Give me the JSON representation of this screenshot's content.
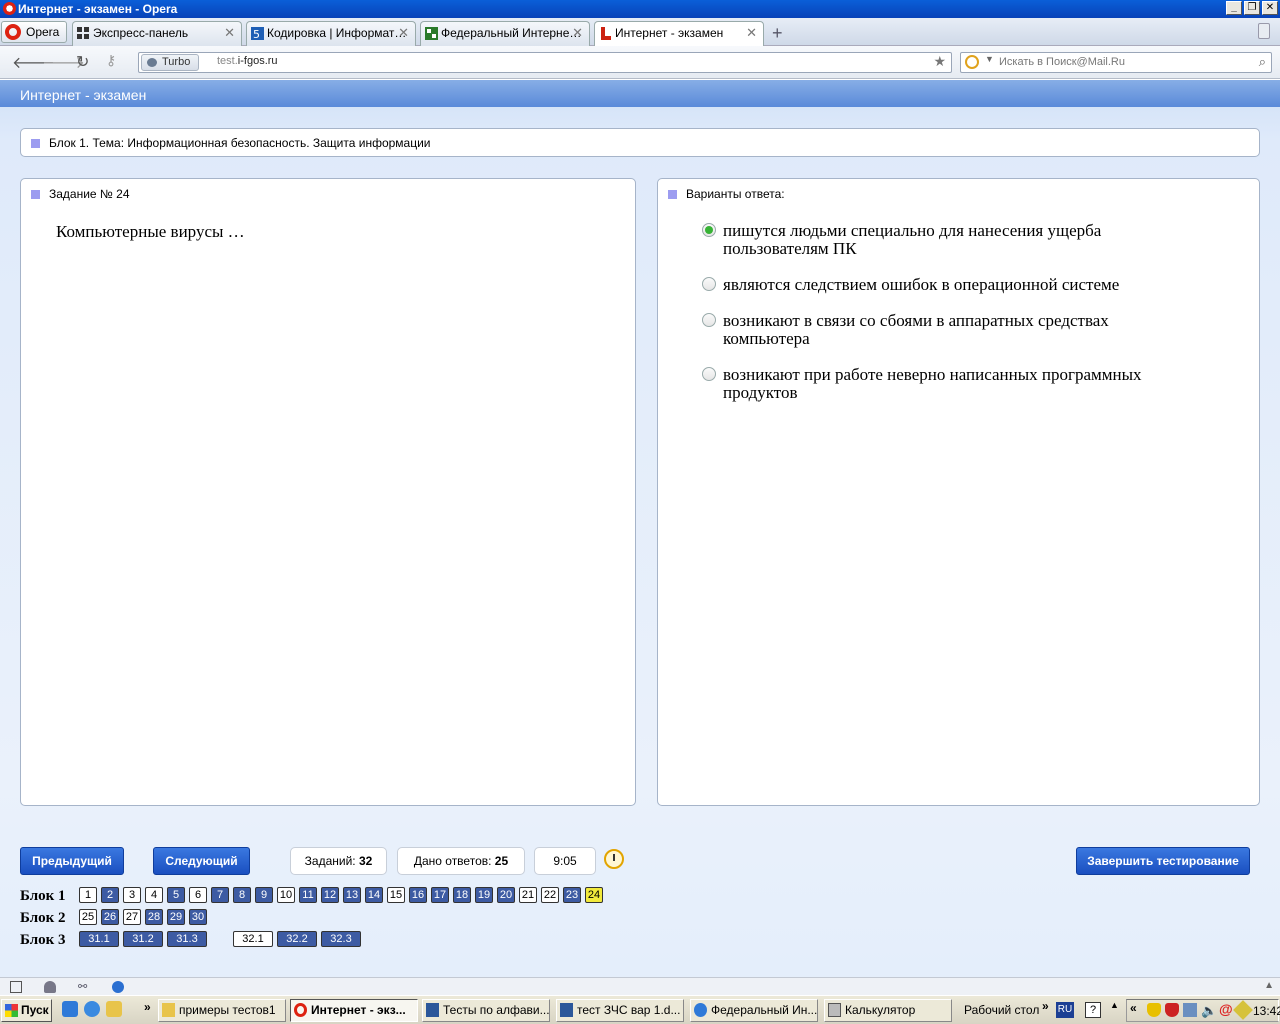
{
  "window": {
    "title": "Интернет - экзамен - Opera"
  },
  "browser": {
    "menu_label": "Opera",
    "tabs": [
      {
        "label": "Экспресс-панель",
        "active": false
      },
      {
        "label": "Кодировка | Информат…",
        "active": false
      },
      {
        "label": "Федеральный Интерне…",
        "active": false
      },
      {
        "label": "Интернет - экзамен",
        "active": true
      }
    ],
    "turbo_label": "Turbo",
    "url_prefix": "test.",
    "url_domain": "i-fgos.ru",
    "search_placeholder": "Искать в Поиск@Mail.Ru"
  },
  "page": {
    "header": "Интернет - экзамен",
    "block_title": "Блок 1. Тема: Информационная безопасность. Защита информации",
    "task_title": "Задание № 24",
    "question": "Компьютерные вирусы …",
    "answers_title": "Варианты ответа:",
    "answers": [
      {
        "text": "пишутся людьми специально для нанесения ущерба пользователям ПК",
        "selected": true
      },
      {
        "text": "являются следствием ошибок в операционной системе",
        "selected": false
      },
      {
        "text": "возникают в связи со сбоями в аппаратных средствах компьютера",
        "selected": false
      },
      {
        "text": "возникают при работе неверно написанных программных продуктов",
        "selected": false
      }
    ],
    "prev_label": "Предыдущий",
    "next_label": "Следующий",
    "tasks_label": "Заданий:",
    "tasks_count": "32",
    "answered_label": "Дано ответов:",
    "answered_count": "25",
    "timer": "9:05",
    "finish_label": "Завершить тестирование",
    "blocks": [
      {
        "label": "Блок 1",
        "items": [
          {
            "n": "1",
            "state": "white"
          },
          {
            "n": "2",
            "state": "blue"
          },
          {
            "n": "3",
            "state": "white"
          },
          {
            "n": "4",
            "state": "white"
          },
          {
            "n": "5",
            "state": "blue"
          },
          {
            "n": "6",
            "state": "white"
          },
          {
            "n": "7",
            "state": "blue"
          },
          {
            "n": "8",
            "state": "blue"
          },
          {
            "n": "9",
            "state": "blue"
          },
          {
            "n": "10",
            "state": "white"
          },
          {
            "n": "11",
            "state": "blue"
          },
          {
            "n": "12",
            "state": "blue"
          },
          {
            "n": "13",
            "state": "blue"
          },
          {
            "n": "14",
            "state": "blue"
          },
          {
            "n": "15",
            "state": "white"
          },
          {
            "n": "16",
            "state": "blue"
          },
          {
            "n": "17",
            "state": "blue"
          },
          {
            "n": "18",
            "state": "blue"
          },
          {
            "n": "19",
            "state": "blue"
          },
          {
            "n": "20",
            "state": "blue"
          },
          {
            "n": "21",
            "state": "white"
          },
          {
            "n": "22",
            "state": "white"
          },
          {
            "n": "23",
            "state": "blue"
          },
          {
            "n": "24",
            "state": "yellow"
          }
        ]
      },
      {
        "label": "Блок 2",
        "items": [
          {
            "n": "25",
            "state": "white"
          },
          {
            "n": "26",
            "state": "blue"
          },
          {
            "n": "27",
            "state": "white"
          },
          {
            "n": "28",
            "state": "blue"
          },
          {
            "n": "29",
            "state": "blue"
          },
          {
            "n": "30",
            "state": "blue"
          }
        ]
      },
      {
        "label": "Блок 3",
        "items": [
          {
            "n": "31.1",
            "state": "blue"
          },
          {
            "n": "31.2",
            "state": "blue"
          },
          {
            "n": "31.3",
            "state": "blue"
          },
          {
            "n": "32.1",
            "state": "white"
          },
          {
            "n": "32.2",
            "state": "blue"
          },
          {
            "n": "32.3",
            "state": "blue"
          }
        ]
      }
    ]
  },
  "taskbar": {
    "start_label": "Пуск",
    "buttons": [
      {
        "label": "примеры тестов1",
        "active": false,
        "icon": "folder-icon"
      },
      {
        "label": "Интернет - экз...",
        "active": true,
        "icon": "opera-icon"
      },
      {
        "label": "Тесты по алфави...",
        "active": false,
        "icon": "word-icon"
      },
      {
        "label": "тест ЗЧС вар 1.d...",
        "active": false,
        "icon": "word-icon"
      },
      {
        "label": "Федеральный Ин...",
        "active": false,
        "icon": "ie-icon"
      },
      {
        "label": "Калькулятор",
        "active": false,
        "icon": "calculator-icon"
      }
    ],
    "desktop_label": "Рабочий стол",
    "lang": "RU",
    "clock": "13:42"
  }
}
